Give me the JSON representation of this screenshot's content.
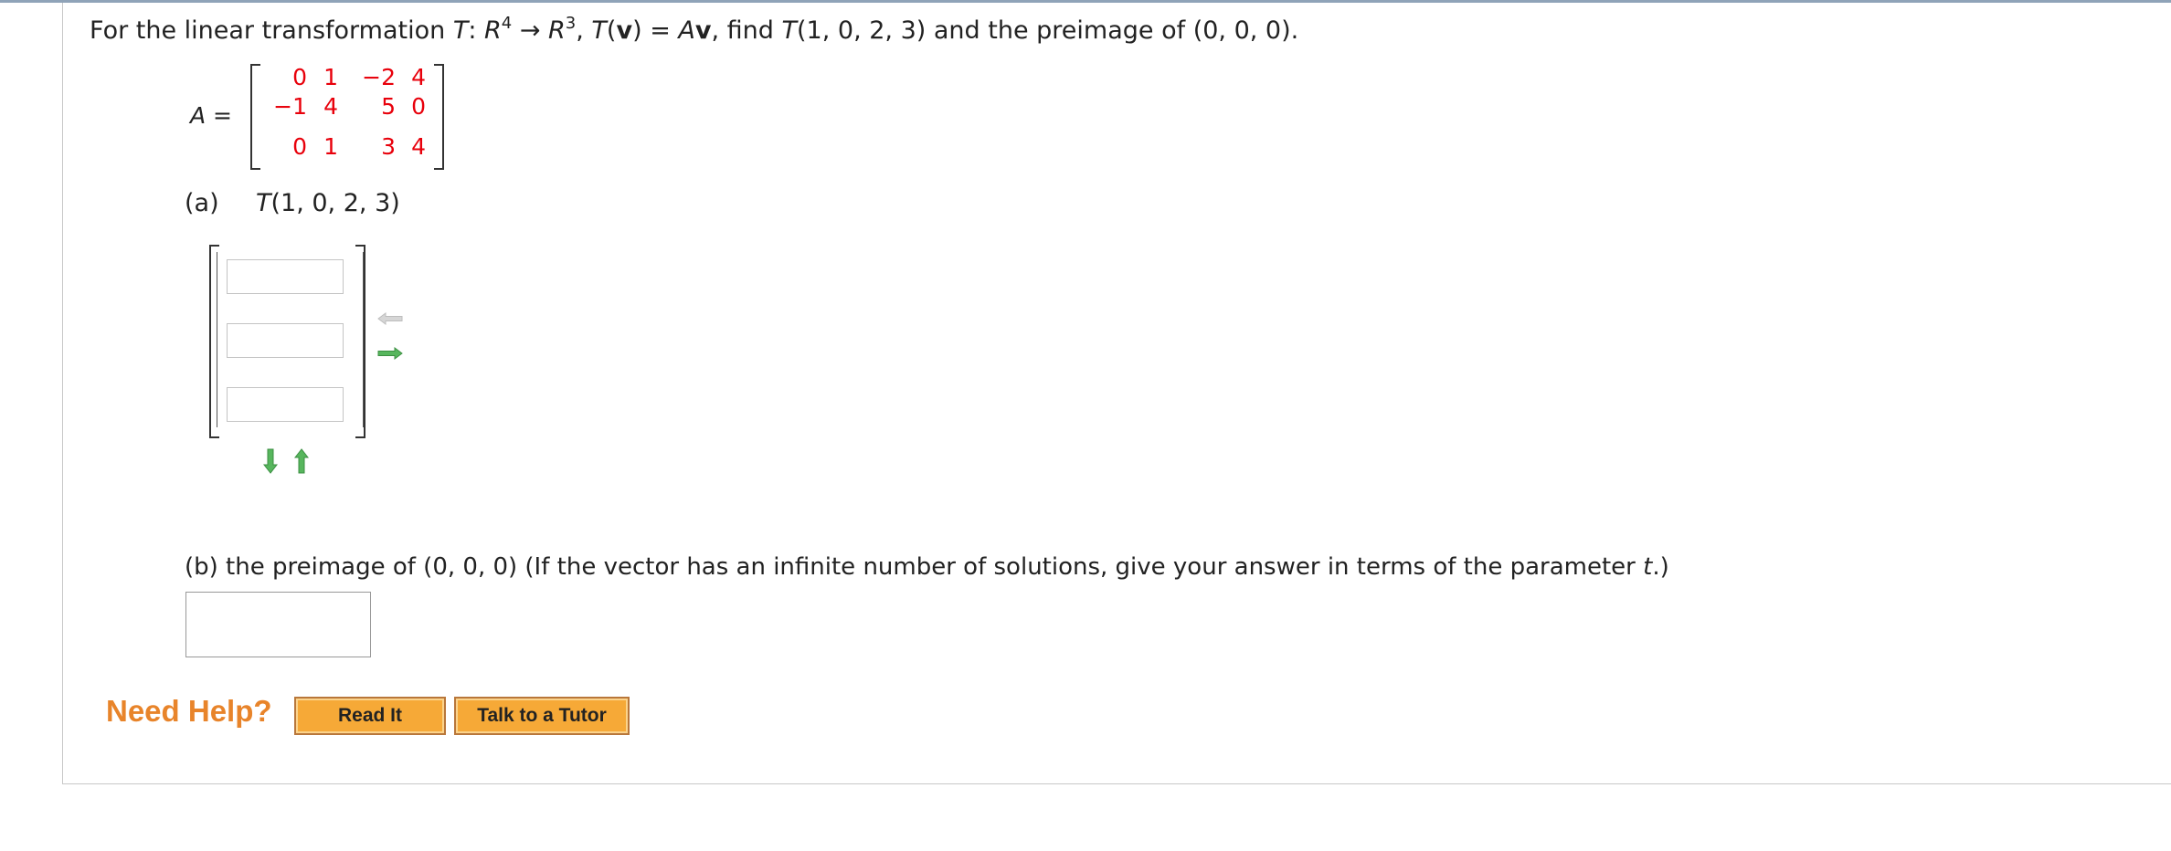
{
  "question": {
    "prefix": "For the linear transformation ",
    "T": "T",
    "colon": ": ",
    "R": "R",
    "dom_exp": "4",
    "arrow": " → ",
    "codom_exp": "3",
    "comma": ", ",
    "Tv_T": "T",
    "Tv_open": "(",
    "Tv_v": "v",
    "Tv_close": ") = ",
    "Av_A": "A",
    "Av_v": "v",
    "suffix_1": ",  find ",
    "find_T": "T",
    "suffix_2": "(1, 0, 2, 3) and the preimage of (0, 0, 0)."
  },
  "matrix": {
    "label": "A =",
    "rows": [
      [
        "0",
        "1",
        "−2",
        "4"
      ],
      [
        "−1",
        "4",
        "5",
        "0"
      ],
      [
        "0",
        "1",
        "3",
        "4"
      ]
    ],
    "color": "#e8000b"
  },
  "part_a": {
    "label": "(a)",
    "expr_T": "T",
    "expr_rest": "(1, 0, 2, 3)",
    "inputs": [
      "",
      "",
      ""
    ],
    "icons": [
      "arrow-left-icon",
      "arrow-right-icon",
      "arrow-down-icon",
      "arrow-up-icon"
    ]
  },
  "part_b": {
    "text_1": "(b) the preimage of (0, 0, 0) (If the vector has an infinite number of solutions, give your answer in terms of the parameter ",
    "param": "t",
    "text_2": ".)",
    "input": ""
  },
  "help": {
    "label": "Need Help?",
    "read_it": "Read It",
    "tutor": "Talk to a Tutor",
    "color": "#e8842a",
    "button_color": "#f6a937"
  }
}
